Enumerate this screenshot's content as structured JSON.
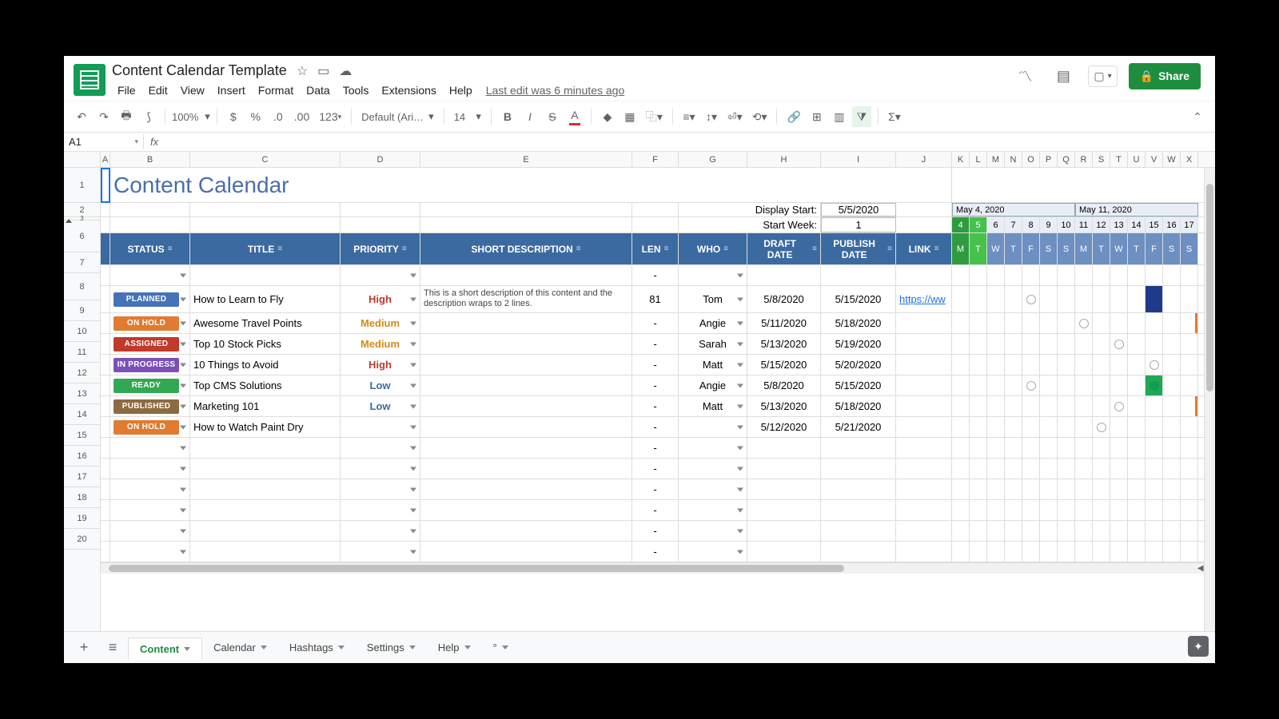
{
  "doc_title": "Content Calendar Template",
  "menus": [
    "File",
    "Edit",
    "View",
    "Insert",
    "Format",
    "Data",
    "Tools",
    "Extensions",
    "Help"
  ],
  "last_edit": "Last edit was 6 minutes ago",
  "share": "Share",
  "toolbar": {
    "zoom": "100%",
    "font": "Default (Ari…",
    "size": "14",
    "currency": "$",
    "percent": "%",
    "dec_dec": ".0",
    "dec_inc": ".00",
    "numfmt": "123"
  },
  "namebox": "A1",
  "columns": [
    "A",
    "B",
    "C",
    "D",
    "E",
    "F",
    "G",
    "H",
    "I",
    "J",
    "K",
    "L",
    "M",
    "N",
    "O",
    "P",
    "Q",
    "R",
    "S",
    "T",
    "U",
    "V",
    "W",
    "X"
  ],
  "title": "Content Calendar",
  "display_start_label": "Display Start:",
  "display_start": "5/5/2020",
  "start_week_label": "Start Week:",
  "start_week": "1",
  "week1_label": "May 4, 2020",
  "week2_label": "May 11, 2020",
  "days1": [
    "4",
    "5",
    "6",
    "7",
    "8",
    "9",
    "10"
  ],
  "days2": [
    "11",
    "12",
    "13",
    "14",
    "15",
    "16",
    "17"
  ],
  "dow": [
    "M",
    "T",
    "W",
    "T",
    "F",
    "S",
    "S",
    "M",
    "T",
    "W",
    "T",
    "F",
    "S",
    "S"
  ],
  "headers": {
    "status": "STATUS",
    "title": "TITLE",
    "priority": "PRIORITY",
    "desc": "SHORT DESCRIPTION",
    "len": "LEN",
    "who": "WHO",
    "draft": "DRAFT DATE",
    "publish": "PUBLISH DATE",
    "link": "LINK"
  },
  "rows": [
    {
      "n": "7",
      "status": "",
      "title": "",
      "priority": "",
      "desc": "",
      "len": "-",
      "who": "",
      "draft": "",
      "publish": "",
      "link": ""
    },
    {
      "n": "8",
      "status": "PLANNED",
      "chip": "planned",
      "title": "How to Learn to Fly",
      "priority": "High",
      "pclass": "prio-high",
      "desc": "This is a short description of this content and the description wraps to 2 lines.",
      "len": "81",
      "who": "Tom",
      "draft": "5/8/2020",
      "publish": "5/15/2020",
      "link": "https://ww"
    },
    {
      "n": "9",
      "status": "ON HOLD",
      "chip": "onhold",
      "title": "Awesome Travel Points",
      "priority": "Medium",
      "pclass": "prio-med",
      "desc": "",
      "len": "-",
      "who": "Angie",
      "draft": "5/11/2020",
      "publish": "5/18/2020",
      "link": ""
    },
    {
      "n": "10",
      "status": "ASSIGNED",
      "chip": "assigned",
      "title": "Top 10 Stock Picks",
      "priority": "Medium",
      "pclass": "prio-med",
      "desc": "",
      "len": "-",
      "who": "Sarah",
      "draft": "5/13/2020",
      "publish": "5/19/2020",
      "link": ""
    },
    {
      "n": "11",
      "status": "IN PROGRESS",
      "chip": "inprogress",
      "title": "10 Things to Avoid",
      "priority": "High",
      "pclass": "prio-high",
      "desc": "",
      "len": "-",
      "who": "Matt",
      "draft": "5/15/2020",
      "publish": "5/20/2020",
      "link": ""
    },
    {
      "n": "12",
      "status": "READY",
      "chip": "ready",
      "title": "Top CMS Solutions",
      "priority": "Low",
      "pclass": "prio-low",
      "desc": "",
      "len": "-",
      "who": "Angie",
      "draft": "5/8/2020",
      "publish": "5/15/2020",
      "link": ""
    },
    {
      "n": "13",
      "status": "PUBLISHED",
      "chip": "published",
      "title": "Marketing 101",
      "priority": "Low",
      "pclass": "prio-low",
      "desc": "",
      "len": "-",
      "who": "Matt",
      "draft": "5/13/2020",
      "publish": "5/18/2020",
      "link": ""
    },
    {
      "n": "14",
      "status": "ON HOLD",
      "chip": "onhold",
      "title": "How to Watch Paint Dry",
      "priority": "",
      "desc": "",
      "len": "-",
      "who": "",
      "draft": "5/12/2020",
      "publish": "5/21/2020",
      "link": ""
    },
    {
      "n": "15",
      "len": "-"
    },
    {
      "n": "16",
      "len": "-"
    },
    {
      "n": "17",
      "len": "-"
    },
    {
      "n": "18",
      "len": "-"
    },
    {
      "n": "19",
      "len": "-"
    },
    {
      "n": "20",
      "len": "-"
    }
  ],
  "tabs": [
    "Content",
    "Calendar",
    "Hashtags",
    "Settings",
    "Help",
    "°"
  ],
  "active_tab": 0
}
